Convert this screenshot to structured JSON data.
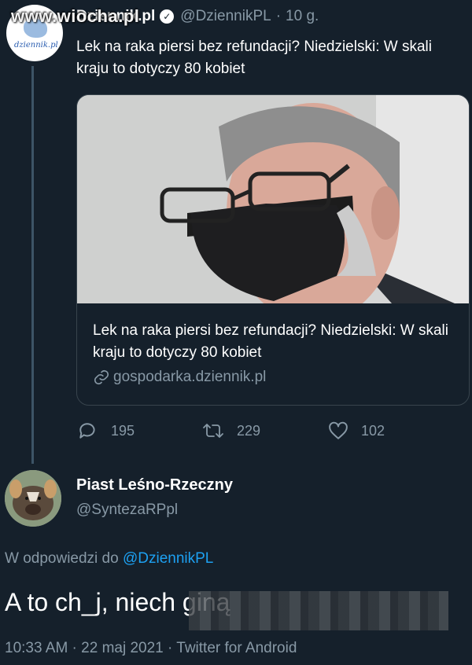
{
  "watermark": "www.wiocha.pl",
  "original_tweet": {
    "author_name": "Dziennik.pl",
    "handle": "@DziennikPL",
    "time": "10 g.",
    "text": "Lek na raka piersi bez refundacji? Niedzielski: W skali kraju to dotyczy 80 kobiet",
    "avatar_text": "dziennik.pl",
    "card": {
      "title": "Lek na raka piersi bez refundacji? Niedzielski: W skali kraju to dotyczy 80 kobiet",
      "domain": "gospodarka.dziennik.pl"
    },
    "actions": {
      "replies": "195",
      "retweets": "229",
      "likes": "102"
    }
  },
  "reply_tweet": {
    "author_name": "Piast Leśno-Rzeczny",
    "handle": "@SyntezaRPpl",
    "reply_to_label": "W odpowiedzi do",
    "reply_to_mention": "@DziennikPL",
    "text": "A to ch_j, niech giną",
    "meta": "10:33 AM · 22 maj 2021 · Twitter for Android"
  },
  "colors": {
    "background": "#15202b",
    "secondary_text": "#8899a6",
    "link": "#1da1f2",
    "border": "#38444d"
  }
}
